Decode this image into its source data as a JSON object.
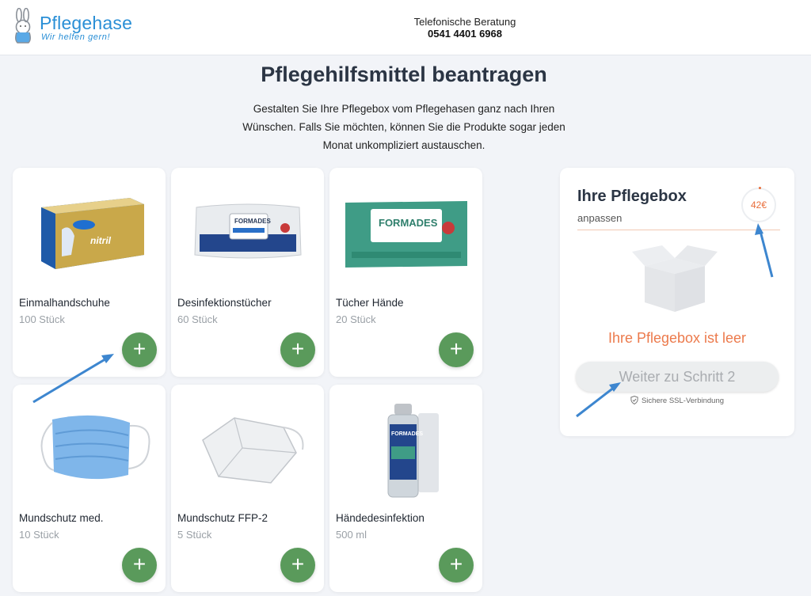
{
  "header": {
    "logo_name": "Pflegehase",
    "logo_tagline": "Wir helfen gern!",
    "phone_label": "Telefonische Beratung",
    "phone_number": "0541 4401 6968"
  },
  "page": {
    "title": "Pflegehilfsmittel beantragen",
    "intro": "Gestalten Sie Ihre Pflegebox vom Pflegehasen ganz nach Ihren Wünschen. Falls Sie möchten, können Sie die Produkte sogar jeden Monat unkompliziert austauschen."
  },
  "products": [
    {
      "name": "Einmalhandschuhe",
      "qty": "100 Stück",
      "icon": "gloves-box-image"
    },
    {
      "name": "Desinfektionstücher",
      "qty": "60 Stück",
      "icon": "disinfection-wipes-image"
    },
    {
      "name": "Tücher Hände",
      "qty": "20 Stück",
      "icon": "hand-wipes-image"
    },
    {
      "name": "Mundschutz med.",
      "qty": "10 Stück",
      "icon": "medical-mask-image"
    },
    {
      "name": "Mundschutz FFP-2",
      "qty": "5 Stück",
      "icon": "ffp2-mask-image"
    },
    {
      "name": "Händedesinfektion",
      "qty": "500 ml",
      "icon": "hand-sanitizer-image"
    }
  ],
  "add_button_symbol": "+",
  "box": {
    "title": "Ihre Pflegebox",
    "subtitle": "anpassen",
    "price": "42€",
    "empty_message": "Ihre Pflegebox ist leer",
    "next_button": "Weiter zu Schritt 2",
    "ssl_text": "Sichere SSL-Verbindung"
  },
  "colors": {
    "brand_blue": "#2a8fd6",
    "add_green": "#5a9a5b",
    "accent_orange": "#ec7a4c",
    "annotation_arrow": "#3d86cf"
  }
}
